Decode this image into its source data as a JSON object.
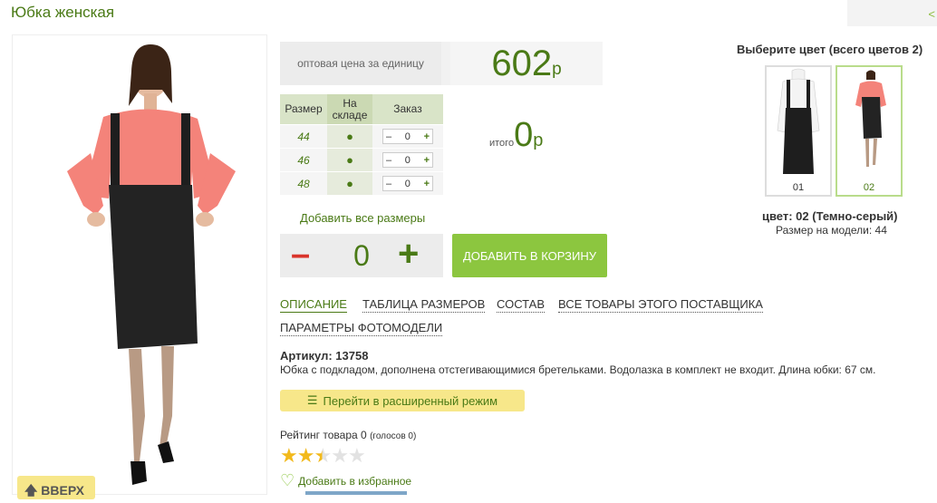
{
  "product": {
    "title": "Юбка женская",
    "article_label": "Артикул: 13758",
    "description": "Юбка с подкладом, дополнена отстегивающимися бретельками. Водолазка в комплект не входит. Длина юбки: 67 см."
  },
  "nav": {
    "up_label": "ВВЕРХ",
    "top_right_label": "<"
  },
  "price": {
    "label": "оптовая цена за единицу",
    "value": "602",
    "currency": "р"
  },
  "size_table": {
    "headers": [
      "Размер",
      "На складе",
      "Заказ"
    ],
    "rows": [
      {
        "size": "44",
        "stock": "●",
        "qty": "0",
        "minus": "–",
        "plus": "+"
      },
      {
        "size": "46",
        "stock": "●",
        "qty": "0",
        "minus": "–",
        "plus": "+"
      },
      {
        "size": "48",
        "stock": "●",
        "qty": "0",
        "minus": "–",
        "plus": "+"
      }
    ]
  },
  "total": {
    "label": "итого",
    "value": "0",
    "currency": "р"
  },
  "add_all_label": "Добавить все размеры",
  "quantity": {
    "minus": "–",
    "value": "0",
    "plus": "+"
  },
  "cart_button": "ДОБАВИТЬ В КОРЗИНУ",
  "tabs": [
    {
      "label": "ОПИСАНИЕ",
      "active": true
    },
    {
      "label": "ТАБЛИЦА РАЗМЕРОВ"
    },
    {
      "label": "СОСТАВ"
    },
    {
      "label": "ВСЕ ТОВАРЫ ЭТОГО ПОСТАВЩИКА"
    },
    {
      "label": "ПАРАМЕТРЫ ФОТОМОДЕЛИ"
    }
  ],
  "advanced_mode_label": "Перейти в расширенный режим",
  "rating": {
    "label": "Рейтинг товара",
    "value": "0",
    "votes": "(голосов 0)",
    "stars_filled": 2.5,
    "stars_total": 5
  },
  "favorite_label": "Добавить в избранное",
  "colors": {
    "title": "Выберите цвет (всего цветов 2)",
    "items": [
      {
        "code": "01",
        "selected": false
      },
      {
        "code": "02",
        "selected": true
      }
    ],
    "current": "цвет: 02 (Темно-серый)",
    "model_size": "Размер на модели: 44"
  },
  "palette": {
    "accent_green": "#4a7a16",
    "button_green": "#8cc63f",
    "minus_red": "#d9342b",
    "yellow": "#f7e78a"
  }
}
